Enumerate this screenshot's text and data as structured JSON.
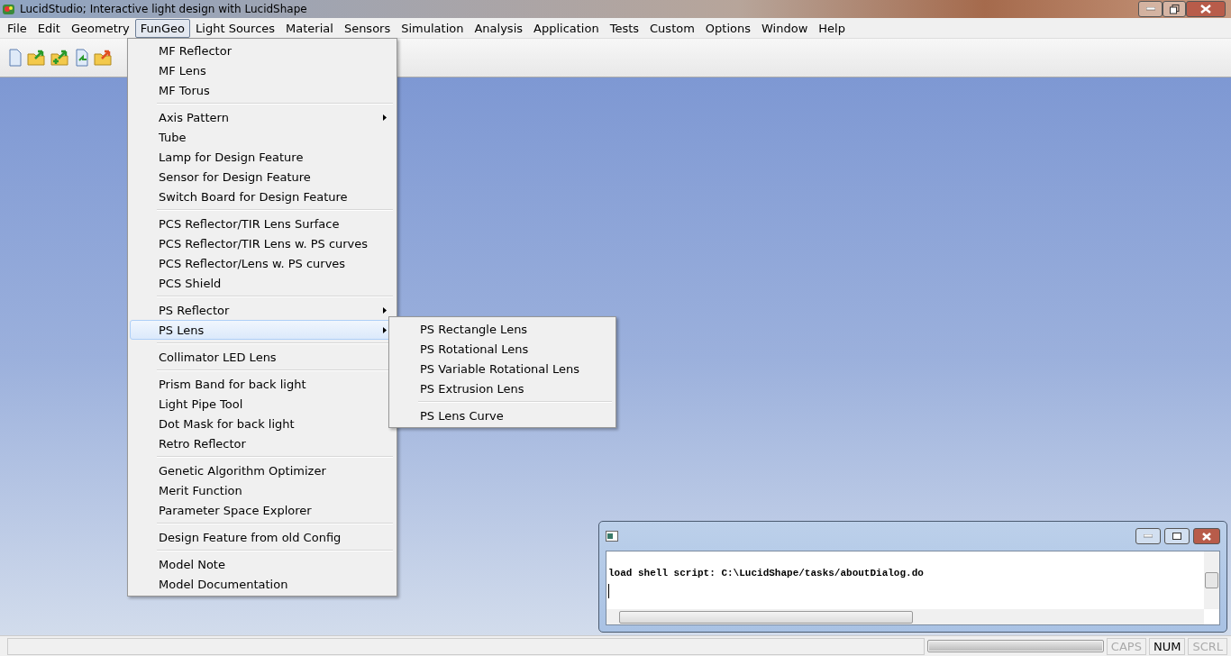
{
  "window": {
    "title": "LucidStudio; Interactive light design with LucidShape"
  },
  "menubar": [
    {
      "label": "File",
      "selected": false
    },
    {
      "label": "Edit",
      "selected": false
    },
    {
      "label": "Geometry",
      "selected": false
    },
    {
      "label": "FunGeo",
      "selected": true
    },
    {
      "label": "Light Sources",
      "selected": false
    },
    {
      "label": "Material",
      "selected": false
    },
    {
      "label": "Sensors",
      "selected": false
    },
    {
      "label": "Simulation",
      "selected": false
    },
    {
      "label": "Analysis",
      "selected": false
    },
    {
      "label": "Application",
      "selected": false
    },
    {
      "label": "Tests",
      "selected": false
    },
    {
      "label": "Custom",
      "selected": false
    },
    {
      "label": "Options",
      "selected": false
    },
    {
      "label": "Window",
      "selected": false
    },
    {
      "label": "Help",
      "selected": false
    }
  ],
  "menu": {
    "sections": [
      [
        {
          "label": "MF Reflector",
          "submenu": false,
          "selected": false
        },
        {
          "label": "MF Lens",
          "submenu": false,
          "selected": false
        },
        {
          "label": "MF Torus",
          "submenu": false,
          "selected": false
        }
      ],
      [
        {
          "label": "Axis Pattern",
          "submenu": true,
          "selected": false
        },
        {
          "label": "Tube",
          "submenu": false,
          "selected": false
        },
        {
          "label": "Lamp for Design Feature",
          "submenu": false,
          "selected": false
        },
        {
          "label": "Sensor for Design Feature",
          "submenu": false,
          "selected": false
        },
        {
          "label": "Switch Board for Design Feature",
          "submenu": false,
          "selected": false
        }
      ],
      [
        {
          "label": "PCS Reflector/TIR Lens Surface",
          "submenu": false,
          "selected": false
        },
        {
          "label": "PCS Reflector/TIR Lens w. PS curves",
          "submenu": false,
          "selected": false
        },
        {
          "label": "PCS Reflector/Lens w. PS curves",
          "submenu": false,
          "selected": false
        },
        {
          "label": "PCS Shield",
          "submenu": false,
          "selected": false
        }
      ],
      [
        {
          "label": "PS Reflector",
          "submenu": true,
          "selected": false
        },
        {
          "label": "PS Lens",
          "submenu": true,
          "selected": true
        }
      ],
      [
        {
          "label": "Collimator LED Lens",
          "submenu": false,
          "selected": false
        }
      ],
      [
        {
          "label": "Prism Band for back light",
          "submenu": false,
          "selected": false
        },
        {
          "label": "Light Pipe Tool",
          "submenu": false,
          "selected": false
        },
        {
          "label": "Dot Mask for back light",
          "submenu": false,
          "selected": false
        },
        {
          "label": "Retro Reflector",
          "submenu": false,
          "selected": false
        }
      ],
      [
        {
          "label": "Genetic Algorithm Optimizer",
          "submenu": false,
          "selected": false
        },
        {
          "label": "Merit Function",
          "submenu": false,
          "selected": false
        },
        {
          "label": "Parameter Space Explorer",
          "submenu": false,
          "selected": false
        }
      ],
      [
        {
          "label": "Design Feature from old Config",
          "submenu": false,
          "selected": false
        }
      ],
      [
        {
          "label": "Model Note",
          "submenu": false,
          "selected": false
        },
        {
          "label": "Model Documentation",
          "submenu": false,
          "selected": false
        }
      ]
    ]
  },
  "submenu": {
    "sections": [
      [
        {
          "label": "PS Rectangle Lens",
          "selected": false
        },
        {
          "label": "PS Rotational Lens",
          "selected": false
        },
        {
          "label": "PS Variable Rotational Lens",
          "selected": false
        },
        {
          "label": "PS Extrusion Lens",
          "selected": false
        }
      ],
      [
        {
          "label": "PS Lens Curve",
          "selected": false
        }
      ]
    ]
  },
  "console": {
    "lines": [
      "load shell script: C:\\LucidShape/tasks/aboutDialog.do"
    ]
  },
  "status_bar": {
    "progress": {
      "level": 1
    },
    "indicators": [
      {
        "label": "CAPS",
        "on": false
      },
      {
        "label": "NUM",
        "on": true
      },
      {
        "label": "SCRL",
        "on": false
      }
    ]
  }
}
